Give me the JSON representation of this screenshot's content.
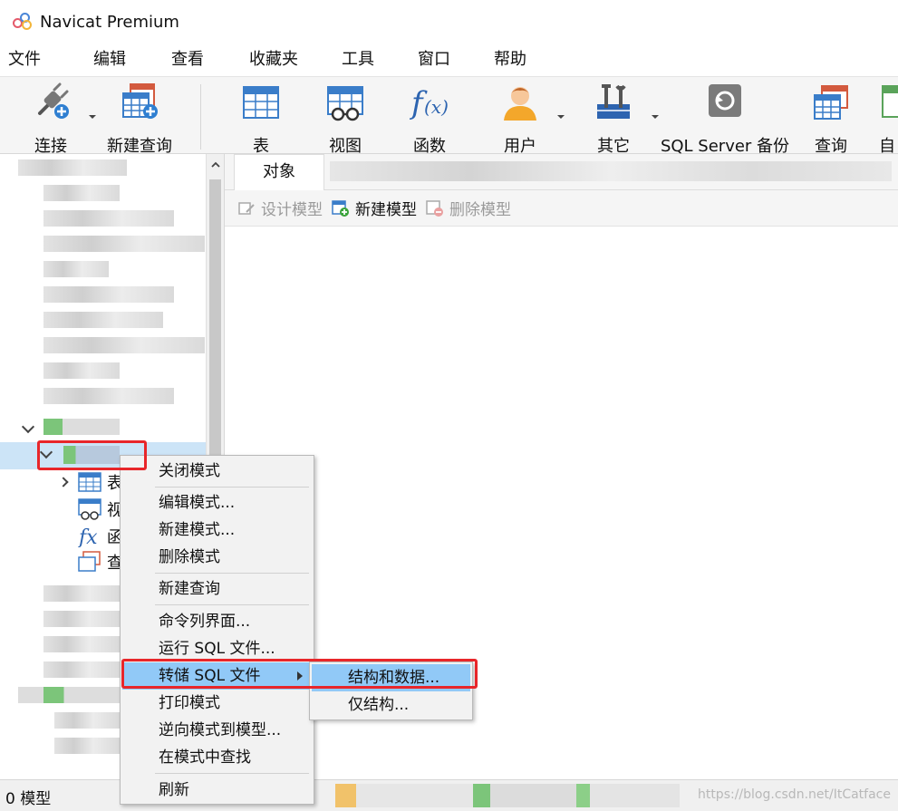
{
  "window": {
    "title": "Navicat Premium"
  },
  "menubar": [
    "文件",
    "编辑",
    "查看",
    "收藏夹",
    "工具",
    "窗口",
    "帮助"
  ],
  "toolbar": [
    {
      "label": "连接",
      "icon": "connection-plug-icon",
      "dropdown": true
    },
    {
      "label": "新建查询",
      "icon": "new-query-icon"
    },
    {
      "label": "表",
      "icon": "table-icon"
    },
    {
      "label": "视图",
      "icon": "view-icon"
    },
    {
      "label": "函数",
      "icon": "function-icon"
    },
    {
      "label": "用户",
      "icon": "user-icon",
      "dropdown": true
    },
    {
      "label": "其它",
      "icon": "tools-icon",
      "dropdown": true
    },
    {
      "label": "SQL Server 备份",
      "icon": "backup-icon"
    },
    {
      "label": "查询",
      "icon": "query-icon"
    },
    {
      "label": "自",
      "icon": "automation-icon"
    }
  ],
  "navigator": {
    "children": [
      {
        "label": "表",
        "icon": "table-icon"
      },
      {
        "label": "视",
        "icon": "view-icon"
      },
      {
        "label": "函",
        "icon": "function-icon"
      },
      {
        "label": "查",
        "icon": "query-icon"
      }
    ]
  },
  "tabs": {
    "objects": "对象"
  },
  "object_toolbar": {
    "design": "设计模型",
    "new": "新建模型",
    "delete": "删除模型"
  },
  "context_menu": [
    "关闭模式",
    "编辑模式...",
    "新建模式...",
    "删除模式",
    "新建查询",
    "命令列界面...",
    "运行 SQL 文件...",
    "转储 SQL 文件",
    "打印模式",
    "逆向模式到模型...",
    "在模式中查找",
    "刷新"
  ],
  "submenu": [
    "结构和数据...",
    "仅结构..."
  ],
  "status": {
    "text": "0 模型",
    "watermark": "https://blog.csdn.net/ItCatface"
  },
  "colors": {
    "accent": "#3a7dc9",
    "highlight": "#91c9f7",
    "selection": "#cce4f7",
    "annotation": "#e8262a"
  }
}
